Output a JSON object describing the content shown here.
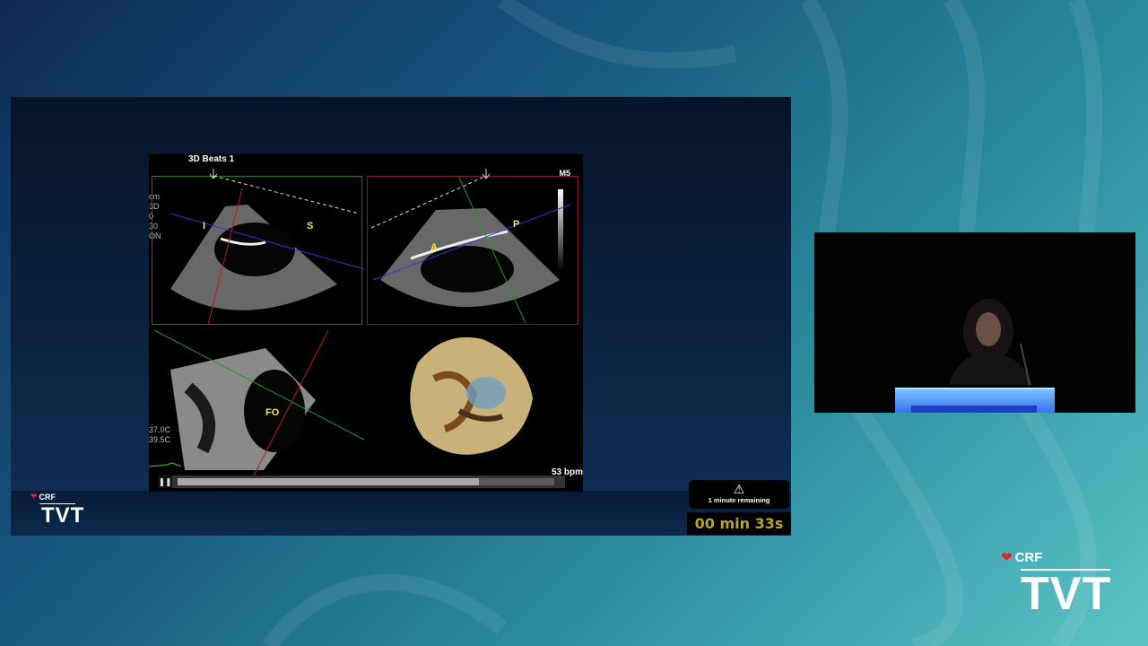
{
  "echo": {
    "title": "3D Beats 1",
    "mode": "M5",
    "bpm": "53 bpm",
    "side_readout_top": [
      "cm",
      "3D",
      "0",
      "30",
      "ON"
    ],
    "side_readout_bottom": [
      "37.0C",
      "39.5C"
    ],
    "labels": {
      "i": "I",
      "s": "S",
      "a": "A",
      "p": "P",
      "fo": "FO"
    },
    "progress_fraction": 0.8
  },
  "timer": {
    "warning_icon": "warning-triangle-icon",
    "message": "1 minute remaining",
    "countdown": "00 min 33s"
  },
  "brand": {
    "small": {
      "crf": "CRF",
      "tvt": "TVT"
    },
    "large": {
      "crf": "CRF",
      "tvt": "TVT"
    },
    "heart_color": "#e8202a"
  },
  "controls": {
    "play_pause_icon": "pause-icon",
    "pause_glyph": "❚❚"
  }
}
